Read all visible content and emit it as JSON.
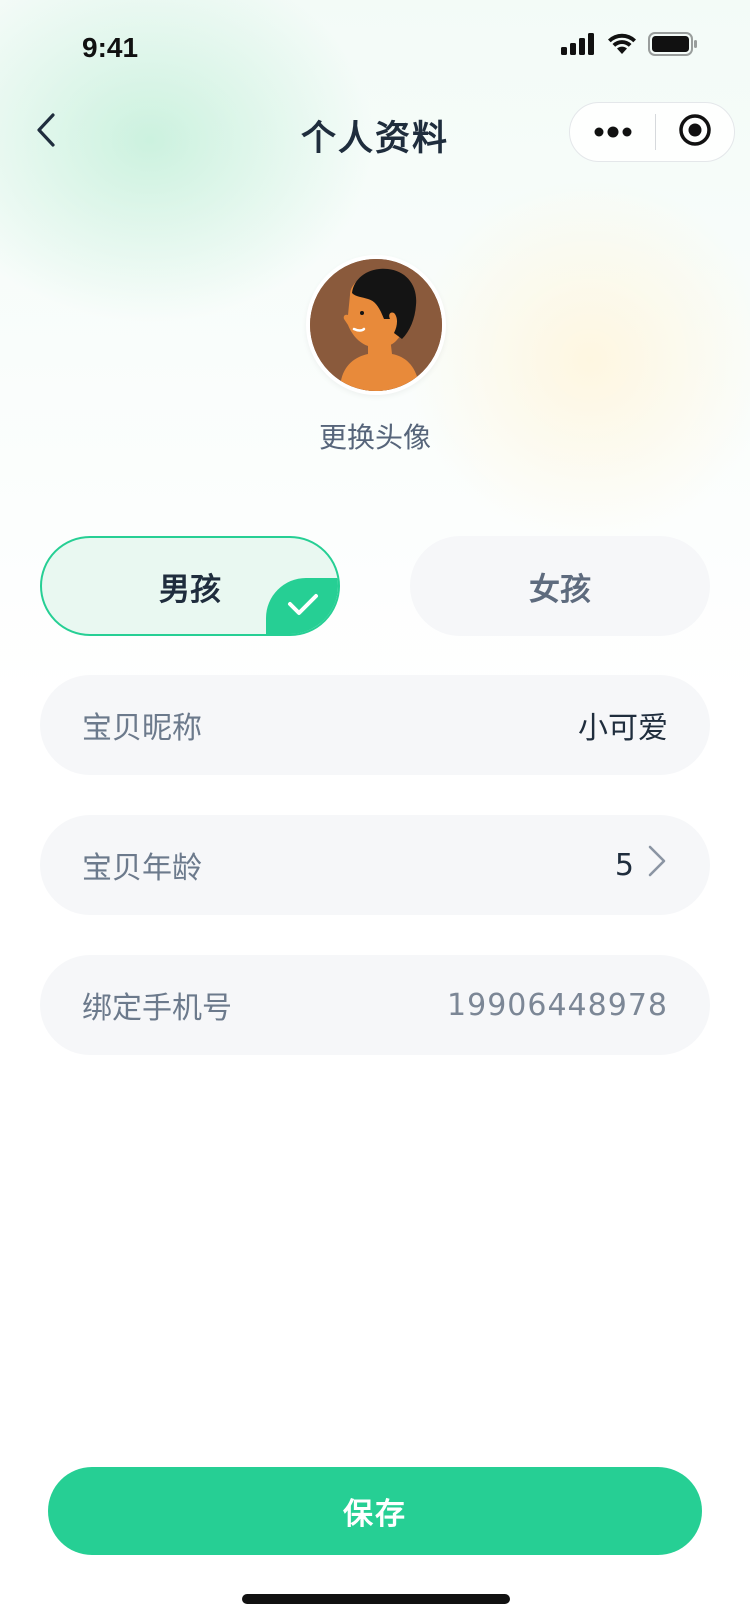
{
  "status_bar": {
    "time": "9:41"
  },
  "nav": {
    "title": "个人资料"
  },
  "avatar": {
    "change_label": "更换头像"
  },
  "gender": {
    "options": [
      {
        "label": "男孩",
        "selected": true
      },
      {
        "label": "女孩",
        "selected": false
      }
    ]
  },
  "form": {
    "nickname": {
      "label": "宝贝昵称",
      "value": "小可爱"
    },
    "age": {
      "label": "宝贝年龄",
      "value": "5"
    },
    "phone": {
      "label": "绑定手机号",
      "value": "19906448978"
    }
  },
  "actions": {
    "save_label": "保存"
  },
  "colors": {
    "accent": "#26cf94",
    "selected_bg": "#e9f8f1",
    "field_bg": "#f6f7f9"
  },
  "icons": [
    "back-arrow-icon",
    "more-dots-icon",
    "target-close-icon",
    "checkmark-icon",
    "chevron-right-icon",
    "signal-icon",
    "wifi-icon",
    "battery-icon"
  ]
}
